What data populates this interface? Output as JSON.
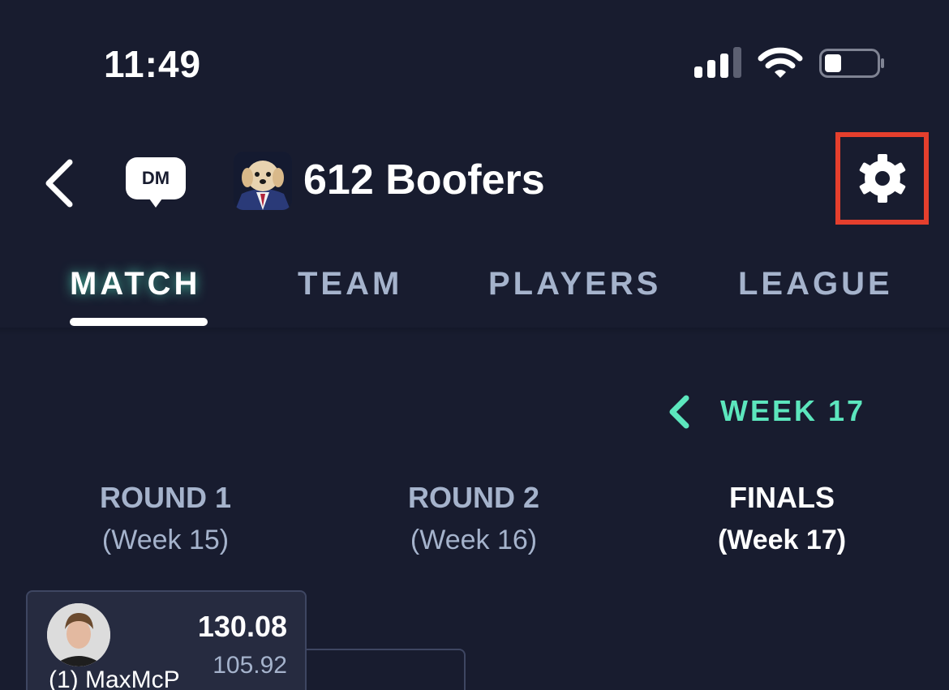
{
  "status_bar": {
    "time": "11:49",
    "signal_bars": 4,
    "signal_bars_filled": 3,
    "battery_level": 0.3
  },
  "header": {
    "back_icon": "chevron-left-icon",
    "dm_label": "DM",
    "team_name": "612 Boofers",
    "settings_icon": "gear-icon",
    "highlight_color": "#e53f2d"
  },
  "tabs": [
    {
      "label": "MATCH",
      "active": true
    },
    {
      "label": "TEAM",
      "active": false
    },
    {
      "label": "PLAYERS",
      "active": false
    },
    {
      "label": "LEAGUE",
      "active": false
    }
  ],
  "week_selector": {
    "prev_icon": "chevron-left-icon",
    "label": "WEEK 17",
    "accent_color": "#5ce6bd"
  },
  "rounds": [
    {
      "title": "ROUND 1",
      "week": "(Week 15)",
      "active": false
    },
    {
      "title": "ROUND 2",
      "week": "(Week 16)",
      "active": false
    },
    {
      "title": "FINALS",
      "week": "(Week 17)",
      "active": true
    }
  ],
  "matchup": {
    "player_name": "(1) MaxMcP",
    "score": "130.08",
    "projected": "105.92"
  },
  "colors": {
    "background": "#181c2f",
    "card": "#262b40",
    "muted_text": "#a5b3cc"
  }
}
